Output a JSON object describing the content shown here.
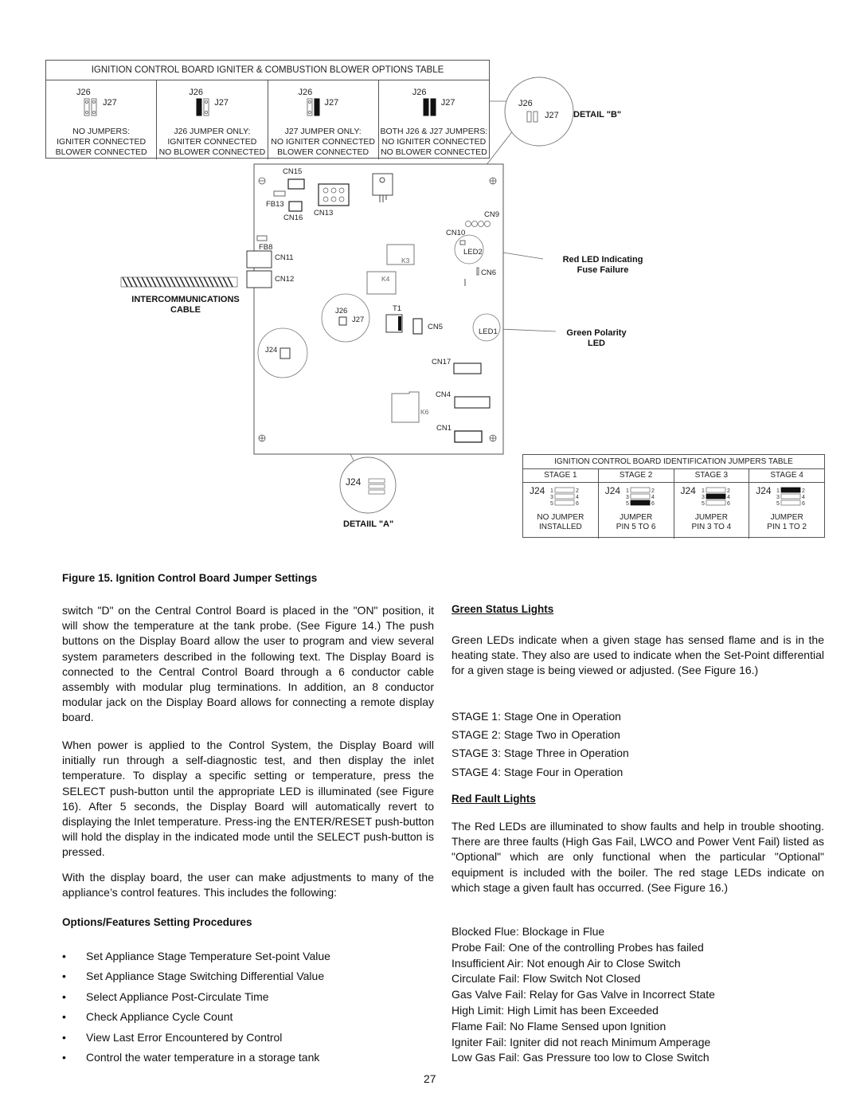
{
  "options_table": {
    "title": "IGNITION CONTROL BOARD IGNITER & COMBUSTION BLOWER OPTIONS TABLE",
    "j26_label": "J26",
    "j27_label": "J27",
    "columns": [
      {
        "j26_jumper": false,
        "j27_jumper": false,
        "lines": [
          "NO JUMPERS:",
          "IGNITER CONNECTED",
          "BLOWER CONNECTED"
        ]
      },
      {
        "j26_jumper": true,
        "j27_jumper": false,
        "lines": [
          "J26 JUMPER ONLY:",
          "IGNITER CONNECTED",
          "NO BLOWER CONNECTED"
        ]
      },
      {
        "j26_jumper": false,
        "j27_jumper": true,
        "lines": [
          "J27 JUMPER ONLY:",
          "NO IGNITER CONNECTED",
          "BLOWER CONNECTED"
        ]
      },
      {
        "j26_jumper": true,
        "j27_jumper": true,
        "lines": [
          "BOTH J26 & J27 JUMPERS:",
          "NO IGNITER CONNECTED",
          "NO BLOWER CONNECTED"
        ]
      }
    ]
  },
  "detail_b": {
    "label": "DETAIL \"B\"",
    "j26": "J26",
    "j27": "J27"
  },
  "detail_a": {
    "label": "DETAIIL \"A\"",
    "j24": "J24",
    "pins": [
      "1",
      "2",
      "3",
      "4",
      "5",
      "6"
    ]
  },
  "board": {
    "components": {
      "cn15": "CN15",
      "fb13": "FB13",
      "cn16": "CN16",
      "cn13": "CN13",
      "cn9": "CN9",
      "cn10": "CN10",
      "led2": "LED2",
      "fb8": "FB8",
      "cn11": "CN11",
      "cn12": "CN12",
      "k3": "K3",
      "k4": "K4",
      "cn6": "CN6",
      "j26": "J26",
      "j27": "J27",
      "t1": "T1",
      "cn5": "CN5",
      "led1": "LED1",
      "j24": "J24",
      "cn17": "CN17",
      "cn4": "CN4",
      "k6": "K6",
      "cn1": "CN1"
    },
    "cable_label": [
      "INTERCOMMUNICATIONS",
      "CABLE"
    ],
    "red_led_label": [
      "Red LED Indicating",
      "Fuse Failure"
    ],
    "green_led_label": [
      "Green Polarity",
      "LED"
    ]
  },
  "ident_table": {
    "title": "IGNITION CONTROL BOARD IDENTIFICATION JUMPERS TABLE",
    "j24_label": "J24",
    "stages": [
      {
        "header": "STAGE 1",
        "jumper_row": 0,
        "lines": [
          "NO JUMPER",
          "INSTALLED"
        ]
      },
      {
        "header": "STAGE 2",
        "jumper_row": 3,
        "lines": [
          "JUMPER",
          "PIN 5 TO 6"
        ]
      },
      {
        "header": "STAGE 3",
        "jumper_row": 2,
        "lines": [
          "JUMPER",
          "PIN 3 TO 4"
        ]
      },
      {
        "header": "STAGE 4",
        "jumper_row": 1,
        "lines": [
          "JUMPER",
          "PIN 1 TO 2"
        ]
      }
    ]
  },
  "figure_caption": "Figure 15.  Ignition Control Board Jumper Settings",
  "left_column": {
    "para1": "switch \"D\" on the Central Control Board is placed in the \"ON\" position, it will show the temperature at the tank probe.  (See Figure 14.)  The push buttons on the Display Board allow the user to program and view several system parameters described in the following text.  The Display Board is connected to the Central Control Board through a 6 conductor cable assembly with modular plug terminations.  In addition, an 8 conductor modular jack on the Display Board allows for connecting a remote display board.",
    "para2": "When power is applied to the Control System, the Display Board will initially run through a self-diagnostic test, and then display the inlet temperature.  To display a specific setting or temperature, press the SELECT push-button until the appropriate LED is illuminated (see Figure 16).  After 5 seconds, the Display Board will automatically revert to displaying the Inlet temperature.  Press-ing the ENTER/RESET push-button will hold the display in the indicated mode until the SELECT push-button is pressed.",
    "para3": "With the display board, the user can make adjustments to many of the appliance’s control features.  This includes the following:",
    "options_heading": "Options/Features Setting Procedures",
    "bullet_glyph": "•",
    "options": [
      "Set Appliance Stage Temperature Set-point Value",
      "Set Appliance Stage Switching Differential Value",
      "Select Appliance Post-Circulate Time",
      "Check Appliance Cycle Count",
      "View Last Error Encountered by Control",
      "Control the water temperature in a storage tank"
    ]
  },
  "right_column": {
    "green_heading": "Green Status Lights",
    "green_para": "Green LEDs indicate when a given stage has sensed flame and is in the heating state.  They also are used to indicate when the Set-Point differential for a given stage is being viewed or adjusted. (See Figure 16.)",
    "stages": [
      "STAGE 1:  Stage One in Operation",
      "STAGE 2:  Stage Two in Operation",
      "STAGE 3:  Stage Three in Operation",
      "STAGE 4:  Stage Four in Operation"
    ],
    "red_heading": "Red Fault Lights",
    "red_para": "The Red LEDs are illuminated to show faults and help in trouble shooting.  There are three faults (High Gas Fail, LWCO and Power Vent Fail) listed as \"Optional\" which are only functional when the particular \"Optional\" equipment is included with the boiler.  The red stage LEDs indicate on which stage a given fault has occurred. (See Figure 16.)",
    "faults": [
      "Blocked Flue:  Blockage in Flue",
      "Probe Fail:  One of the controlling Probes has failed",
      "Insufficient Air:  Not enough Air to Close Switch",
      "Circulate Fail:  Flow Switch Not Closed",
      "Gas Valve Fail:  Relay for Gas Valve in Incorrect State",
      "High Limit:  High Limit has been Exceeded",
      "Flame Fail:  No Flame Sensed upon Ignition",
      "Igniter Fail:  Igniter did not reach Minimum Amperage",
      "Low Gas Fail:  Gas Pressure too low to Close Switch"
    ]
  },
  "page_number": "27"
}
